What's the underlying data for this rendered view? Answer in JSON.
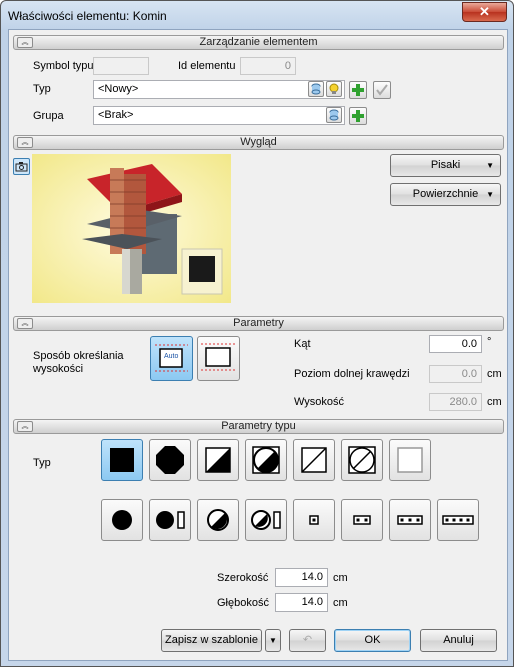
{
  "window": {
    "title": "Właściwości elementu: Komin",
    "close": "✕"
  },
  "sections": {
    "zarzadzanie": "Zarządzanie elementem",
    "wyglad": "Wygląd",
    "parametry": "Parametry",
    "parametry_typu": "Parametry typu"
  },
  "mgmt": {
    "symbol_label": "Symbol typu",
    "symbol_value": "",
    "id_label": "Id elementu",
    "id_value": "0",
    "typ_label": "Typ",
    "typ_value": "<Nowy>",
    "grupa_label": "Grupa",
    "grupa_value": "<Brak>"
  },
  "appearance": {
    "pisaki": "Pisaki",
    "powierzchnie": "Powierzchnie"
  },
  "params": {
    "sposob_label": "Sposób określania wysokości",
    "auto_text": "Auto",
    "kat_label": "Kąt",
    "kat_value": "0.0",
    "kat_unit": "°",
    "poziom_label": "Poziom dolnej krawędzi",
    "poziom_value": "0.0",
    "poziom_unit": "cm",
    "wys_label": "Wysokość",
    "wys_value": "280.0",
    "wys_unit": "cm"
  },
  "type_params": {
    "typ_label": "Typ",
    "szer_label": "Szerokość",
    "szer_value": "14.0",
    "szer_unit": "cm",
    "gleb_label": "Głębokość",
    "gleb_value": "14.0",
    "gleb_unit": "cm"
  },
  "footer": {
    "save": "Zapisz w szablonie",
    "ok": "OK",
    "cancel": "Anuluj"
  },
  "colors": {
    "plus": "#2fa12f",
    "accent": "#3c7fb1"
  }
}
